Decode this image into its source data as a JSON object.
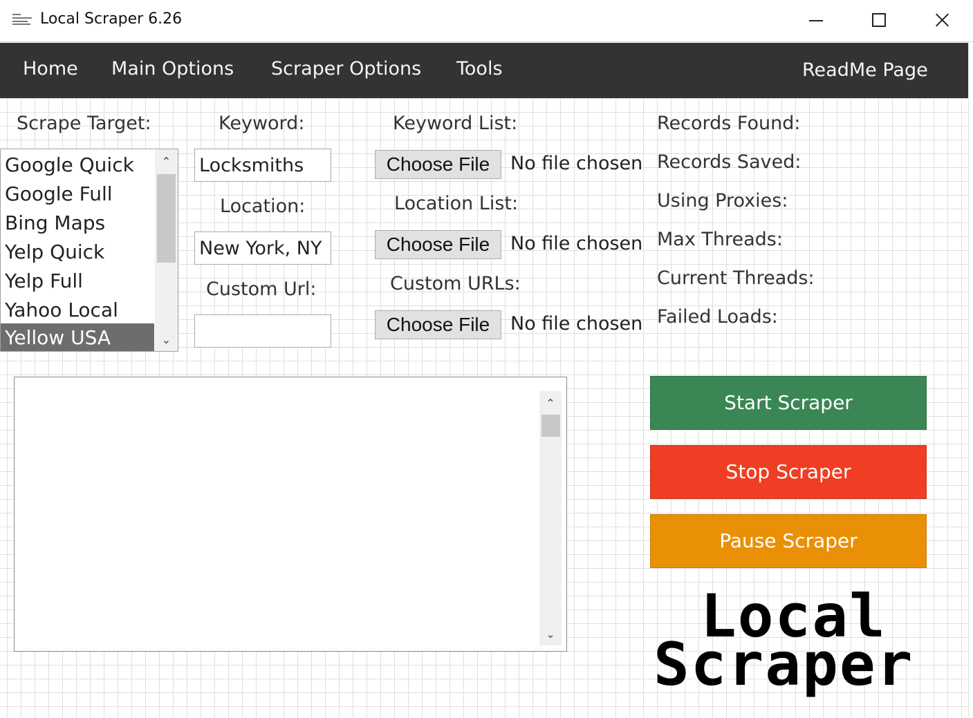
{
  "window": {
    "title": "Local Scraper 6.26",
    "icon": "app-logo-icon",
    "controls": [
      "minimize-icon",
      "maximize-icon",
      "close-icon"
    ]
  },
  "nav": {
    "home": "Home",
    "main_options": "Main Options",
    "scraper_options": "Scraper Options",
    "tools": "Tools",
    "readme": "ReadMe Page"
  },
  "form": {
    "scrape_target_label": "Scrape Target:",
    "targets": [
      "Google Quick",
      "Google Full",
      "Bing Maps",
      "Yelp Quick",
      "Yelp Full",
      "Yahoo Local",
      "Yellow USA"
    ],
    "selected_target": "Yellow USA",
    "keyword_label": "Keyword:",
    "keyword_value": "Locksmiths",
    "location_label": "Location:",
    "location_value": "New York, NY",
    "custom_url_label": "Custom Url:",
    "custom_url_value": ""
  },
  "files": {
    "keyword_list_label": "Keyword List:",
    "location_list_label": "Location List:",
    "custom_urls_label": "Custom URLs:",
    "choose_file": "Choose File",
    "no_file": "No file chosen"
  },
  "stats": {
    "records_found": "Records Found:",
    "records_saved": "Records Saved:",
    "using_proxies": "Using Proxies:",
    "max_threads": "Max Threads:",
    "current_threads": "Current Threads:",
    "failed_loads": "Failed Loads:"
  },
  "log": {
    "content": ""
  },
  "actions": {
    "start": "Start Scraper",
    "stop": "Stop Scraper",
    "pause": "Pause Scraper"
  },
  "logo": {
    "line1": "Local",
    "line2": "Scraper"
  },
  "colors": {
    "navbar": "#333333",
    "start": "#3a8755",
    "stop": "#ef3e23",
    "pause": "#ea9006",
    "selection": "#6d6d6d"
  }
}
